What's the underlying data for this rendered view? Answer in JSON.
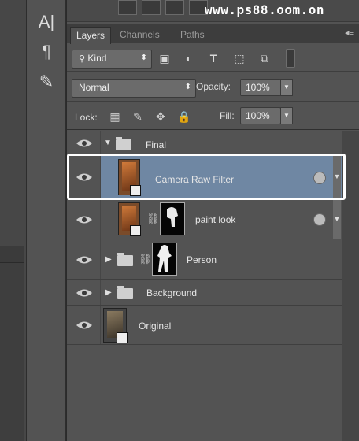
{
  "watermark": "www.ps88.oom.on",
  "tools": {
    "type_tool_glyph": "A|",
    "paragraph_glyph": "¶",
    "brush_set_glyph": "✎"
  },
  "tabs": [
    {
      "label": "Layers",
      "active": true
    },
    {
      "label": "Channels",
      "active": false
    },
    {
      "label": "Paths",
      "active": false
    }
  ],
  "panel_menu_glyph": "◂≡",
  "filter": {
    "kind_label": "Kind",
    "kind_icon": "search-icon",
    "chevron": "⬍"
  },
  "blend": {
    "mode": "Normal",
    "opacity_label": "Opacity:",
    "opacity_value": "100%",
    "chevron": "⬍"
  },
  "lock": {
    "label": "Lock:",
    "fill_label": "Fill:",
    "fill_value": "100%"
  },
  "layers": [
    {
      "name": "Final",
      "type": "group",
      "expanded": true
    },
    {
      "name": "Camera Raw Filter",
      "type": "smart",
      "selected": true
    },
    {
      "name": "paint look",
      "type": "smart-masked"
    },
    {
      "name": "Person",
      "type": "group-masked",
      "expanded": false
    },
    {
      "name": "Background",
      "type": "group",
      "expanded": false
    },
    {
      "name": "Original",
      "type": "smart"
    }
  ],
  "colors": {
    "selected_row": "#6f87a3",
    "panel": "#535353",
    "highlight_border": "#ffffff"
  }
}
